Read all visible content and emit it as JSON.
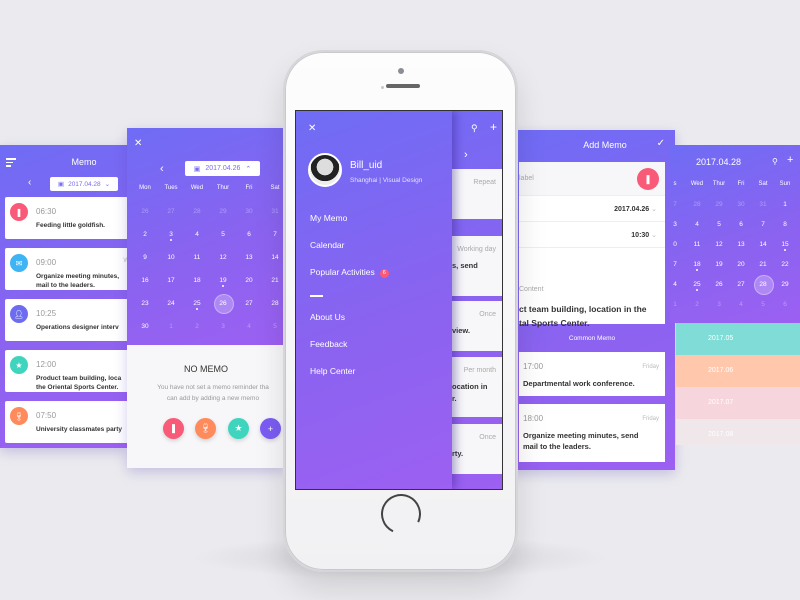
{
  "colors": {
    "accent": "#7a66f2",
    "red": "#f85a78",
    "blue": "#3fb4f5",
    "indigo": "#6d6cf0",
    "teal": "#3fd4be",
    "orange": "#ff8a5c",
    "purple": "#8b5cf5"
  },
  "memo_list": {
    "title": "Memo",
    "date": "2017.04.28",
    "items": [
      {
        "time": "06:30",
        "text": "Feeding little goldfish.",
        "icon": "bookmark-icon",
        "tag": ""
      },
      {
        "time": "09:00",
        "text": "Organize meeting minutes,\nmail to the leaders.",
        "line1": "Organize meeting minutes,",
        "line2": "mail to the leaders.",
        "icon": "mail-icon",
        "tag": "W"
      },
      {
        "time": "10:25",
        "text": "Operations designer interview.",
        "line1": "Operations designer interv",
        "icon": "person-icon",
        "tag": ""
      },
      {
        "time": "12:00",
        "line1": "Product team building, loca",
        "line2": "the Oriental Sports Center.",
        "icon": "star-icon",
        "tag": ""
      },
      {
        "time": "07:50",
        "line1": "University classmates party",
        "icon": "cup-icon",
        "tag": ""
      }
    ]
  },
  "calendar": {
    "date": "2017.04.26",
    "weekdays": [
      "Mon",
      "Tues",
      "Wed",
      "Thur",
      "Fri",
      "Sat"
    ],
    "rows": [
      [
        "26",
        "27",
        "28",
        "29",
        "30",
        "31"
      ],
      [
        "2",
        "3",
        "4",
        "5",
        "6",
        "7"
      ],
      [
        "9",
        "10",
        "11",
        "12",
        "13",
        "14"
      ],
      [
        "16",
        "17",
        "18",
        "19",
        "20",
        "21"
      ],
      [
        "23",
        "24",
        "25",
        "26",
        "27",
        "28"
      ],
      [
        "30",
        "1",
        "2",
        "3",
        "4",
        "5"
      ]
    ],
    "selected": "26",
    "empty_title": "NO MEMO",
    "empty_line1": "You have not set a memo reminder tha",
    "empty_line2": "can add by adding a new memo"
  },
  "drawer": {
    "username": "Bill_uid",
    "location": "Shanghai",
    "role": "Visual Design",
    "sub": "Shanghai  |  Visual Design",
    "menu": [
      "My Memo",
      "Calendar",
      "Popular Activities",
      "About Us",
      "Feedback",
      "Help Center"
    ],
    "badge": "6",
    "background_cards": [
      {
        "tag": "Repeat",
        "line1": ""
      },
      {
        "tag": "Working day",
        "line1": "s, send"
      },
      {
        "tag": "Once",
        "line1": "view."
      },
      {
        "tag": "Per month",
        "line1": "ocation in",
        "line2": "r."
      },
      {
        "tag": "Once",
        "line1": "rty."
      }
    ]
  },
  "add_memo": {
    "title": "Add Memo",
    "label_placeholder": "label",
    "date": "2017.04.26",
    "time": "10:30",
    "content_label": "Content",
    "content_line1": "ct team building, location in the",
    "content_line2": "tal Sports Center.",
    "common_title": "Common Memo",
    "common": [
      {
        "time": "17:00",
        "day": "Friday",
        "line1": "Departmental work conference.",
        "line2": ""
      },
      {
        "time": "18:00",
        "day": "Friday",
        "line1": "Organize meeting minutes, send",
        "line2": "mail to the leaders."
      }
    ]
  },
  "month_view": {
    "title": "2017.04.28",
    "weekdays": [
      "s",
      "Wed",
      "Thur",
      "Fri",
      "Sat",
      "Sun"
    ],
    "rows": [
      [
        "7",
        "28",
        "29",
        "30",
        "31",
        "1"
      ],
      [
        "3",
        "4",
        "5",
        "6",
        "7",
        "8"
      ],
      [
        "0",
        "11",
        "12",
        "13",
        "14",
        "15"
      ],
      [
        "7",
        "18",
        "19",
        "20",
        "21",
        "22"
      ],
      [
        "4",
        "25",
        "26",
        "27",
        "28",
        "29"
      ],
      [
        "1",
        "2",
        "3",
        "4",
        "5",
        "6"
      ]
    ],
    "selected": "28",
    "months": [
      {
        "label": "2017.05",
        "color": "#7fdcd6"
      },
      {
        "label": "2017.06",
        "color": "#ffc8ad"
      },
      {
        "label": "2017.07",
        "color": "#f7d5dd"
      },
      {
        "label": "2017.08",
        "color": "#efe7e9"
      }
    ]
  }
}
